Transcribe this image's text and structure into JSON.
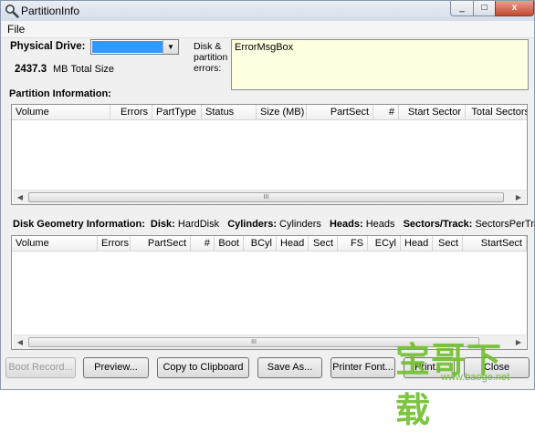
{
  "window": {
    "title": "PartitionInfo",
    "close_glyph": "x",
    "min_glyph": "_",
    "max_glyph": "□"
  },
  "menu": {
    "file": "File"
  },
  "physical_drive": {
    "label": "Physical Drive:",
    "size_value": "2437.3",
    "size_unit": "MB Total Size"
  },
  "errors": {
    "label_line1": "Disk &",
    "label_line2": "partition",
    "label_line3": "errors:",
    "text": "ErrorMsgBox"
  },
  "partition_info": {
    "heading": "Partition Information:",
    "columns": [
      "Volume",
      "Errors",
      "PartType",
      "Status",
      "Size (MB)",
      "PartSect",
      "#",
      "Start Sector",
      "Total Sectors"
    ]
  },
  "geometry": {
    "heading": "Disk Geometry Information:",
    "disk_label": "Disk:",
    "disk_value": "HardDisk",
    "cyl_label": "Cylinders:",
    "cyl_value": "Cylinders",
    "heads_label": "Heads:",
    "heads_value": "Heads",
    "spt_label": "Sectors/Track:",
    "spt_value": "SectorsPerTrack",
    "columns": [
      "Volume",
      "Errors",
      "PartSect",
      "#",
      "Boot",
      "BCyl",
      "Head",
      "Sect",
      "FS",
      "ECyl",
      "Head",
      "Sect",
      "StartSect"
    ]
  },
  "scroll": {
    "left": "◀",
    "right": "▶",
    "grip": "III"
  },
  "buttons": {
    "boot_record": "Boot Record...",
    "preview": "Preview...",
    "copy": "Copy to Clipboard",
    "save_as": "Save As...",
    "printer_font": "Printer Font...",
    "print": "Print...",
    "close": "Close"
  },
  "watermark": {
    "text": "宝哥下载",
    "url": "www.baoge.net"
  },
  "colors": {
    "selection": "#3399ff",
    "error_bg": "#ffffe1",
    "watermark": "#6fbf2d"
  }
}
